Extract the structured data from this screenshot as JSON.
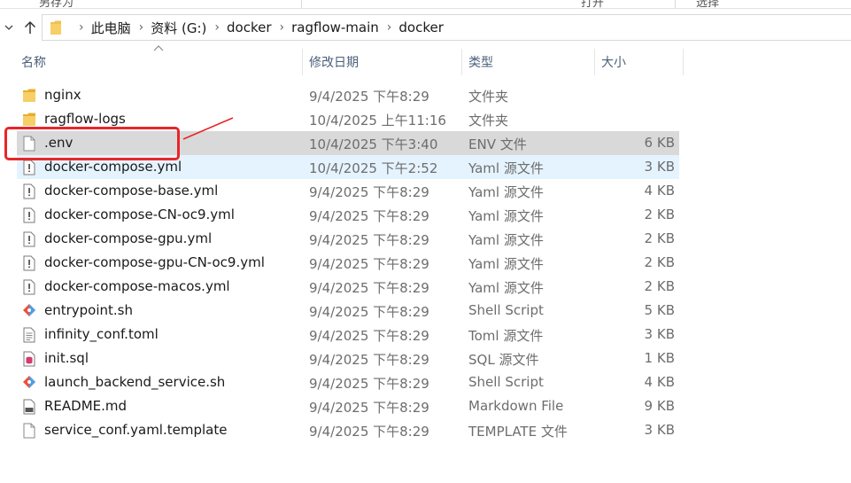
{
  "ribbon": {
    "items": [
      "另存为",
      "打开",
      "选择"
    ]
  },
  "address": {
    "crumbs": [
      "此电脑",
      "资料 (G:)",
      "docker",
      "ragflow-main",
      "docker"
    ]
  },
  "columns": {
    "name": "名称",
    "date": "修改日期",
    "type": "类型",
    "size": "大小"
  },
  "files": [
    {
      "name": "nginx",
      "date": "9/4/2025 下午8:29",
      "type": "文件夹",
      "size": "",
      "icon": "folder-icon"
    },
    {
      "name": "ragflow-logs",
      "date": "10/4/2025 上午11:16",
      "type": "文件夹",
      "size": "",
      "icon": "folder-icon"
    },
    {
      "name": ".env",
      "date": "10/4/2025 下午3:40",
      "type": "ENV 文件",
      "size": "6 KB",
      "icon": "blank-file-icon",
      "state": "selected"
    },
    {
      "name": "docker-compose.yml",
      "date": "10/4/2025 下午2:52",
      "type": "Yaml 源文件",
      "size": "3 KB",
      "icon": "yaml-file-icon",
      "state": "hover"
    },
    {
      "name": "docker-compose-base.yml",
      "date": "9/4/2025 下午8:29",
      "type": "Yaml 源文件",
      "size": "4 KB",
      "icon": "yaml-file-icon"
    },
    {
      "name": "docker-compose-CN-oc9.yml",
      "date": "9/4/2025 下午8:29",
      "type": "Yaml 源文件",
      "size": "2 KB",
      "icon": "yaml-file-icon"
    },
    {
      "name": "docker-compose-gpu.yml",
      "date": "9/4/2025 下午8:29",
      "type": "Yaml 源文件",
      "size": "2 KB",
      "icon": "yaml-file-icon"
    },
    {
      "name": "docker-compose-gpu-CN-oc9.yml",
      "date": "9/4/2025 下午8:29",
      "type": "Yaml 源文件",
      "size": "2 KB",
      "icon": "yaml-file-icon"
    },
    {
      "name": "docker-compose-macos.yml",
      "date": "9/4/2025 下午8:29",
      "type": "Yaml 源文件",
      "size": "2 KB",
      "icon": "yaml-file-icon"
    },
    {
      "name": "entrypoint.sh",
      "date": "9/4/2025 下午8:29",
      "type": "Shell Script",
      "size": "5 KB",
      "icon": "git-shell-icon"
    },
    {
      "name": "infinity_conf.toml",
      "date": "9/4/2025 下午8:29",
      "type": "Toml 源文件",
      "size": "3 KB",
      "icon": "text-file-icon"
    },
    {
      "name": "init.sql",
      "date": "9/4/2025 下午8:29",
      "type": "SQL 源文件",
      "size": "1 KB",
      "icon": "sql-file-icon"
    },
    {
      "name": "launch_backend_service.sh",
      "date": "9/4/2025 下午8:29",
      "type": "Shell Script",
      "size": "4 KB",
      "icon": "git-shell-icon"
    },
    {
      "name": "README.md",
      "date": "9/4/2025 下午8:29",
      "type": "Markdown File",
      "size": "9 KB",
      "icon": "markdown-file-icon"
    },
    {
      "name": "service_conf.yaml.template",
      "date": "9/4/2025 下午8:29",
      "type": "TEMPLATE 文件",
      "size": "3 KB",
      "icon": "blank-file-icon"
    }
  ],
  "colors": {
    "selected_row": "#d9d9d9",
    "hover_row": "#e5f3ff",
    "annotation": "#e8262a",
    "folder": "#f2c14e"
  }
}
